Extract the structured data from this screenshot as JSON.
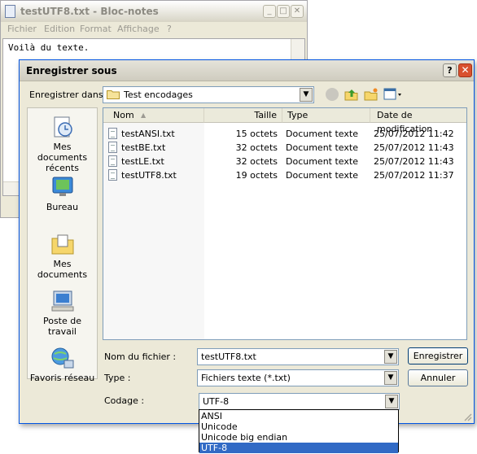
{
  "notepad": {
    "title": "testUTF8.txt - Bloc-notes",
    "menu": [
      "Fichier",
      "Edition",
      "Format",
      "Affichage",
      "?"
    ],
    "content": "Voilà du texte."
  },
  "dialog": {
    "title": "Enregistrer sous",
    "save_in_label": "Enregistrer dans :",
    "save_in_value": "Test encodages",
    "places": [
      {
        "label": "Mes documents récents",
        "icon": "recent-documents-icon"
      },
      {
        "label": "Bureau",
        "icon": "desktop-icon"
      },
      {
        "label": "Mes documents",
        "icon": "my-documents-icon"
      },
      {
        "label": "Poste de travail",
        "icon": "my-computer-icon"
      },
      {
        "label": "Favoris réseau",
        "icon": "network-places-icon"
      }
    ],
    "columns": [
      "Nom",
      "Taille",
      "Type",
      "Date de modification"
    ],
    "files": [
      {
        "name": "testANSI.txt",
        "size": "15 octets",
        "type": "Document texte",
        "date": "25/07/2012 11:42"
      },
      {
        "name": "testBE.txt",
        "size": "32 octets",
        "type": "Document texte",
        "date": "25/07/2012 11:43"
      },
      {
        "name": "testLE.txt",
        "size": "32 octets",
        "type": "Document texte",
        "date": "25/07/2012 11:43"
      },
      {
        "name": "testUTF8.txt",
        "size": "19 octets",
        "type": "Document texte",
        "date": "25/07/2012 11:37"
      }
    ],
    "filename_label": "Nom du fichier :",
    "filename_value": "testUTF8.txt",
    "type_label": "Type :",
    "type_value": "Fichiers texte (*.txt)",
    "encoding_label": "Codage :",
    "encoding_value": "UTF-8",
    "encoding_options": [
      "ANSI",
      "Unicode",
      "Unicode big endian",
      "UTF-8"
    ],
    "save_button": "Enregistrer",
    "cancel_button": "Annuler"
  },
  "colors": {
    "accent": "#316ac5",
    "close": "#d9502f",
    "dialog_bg": "#ece9d8"
  }
}
